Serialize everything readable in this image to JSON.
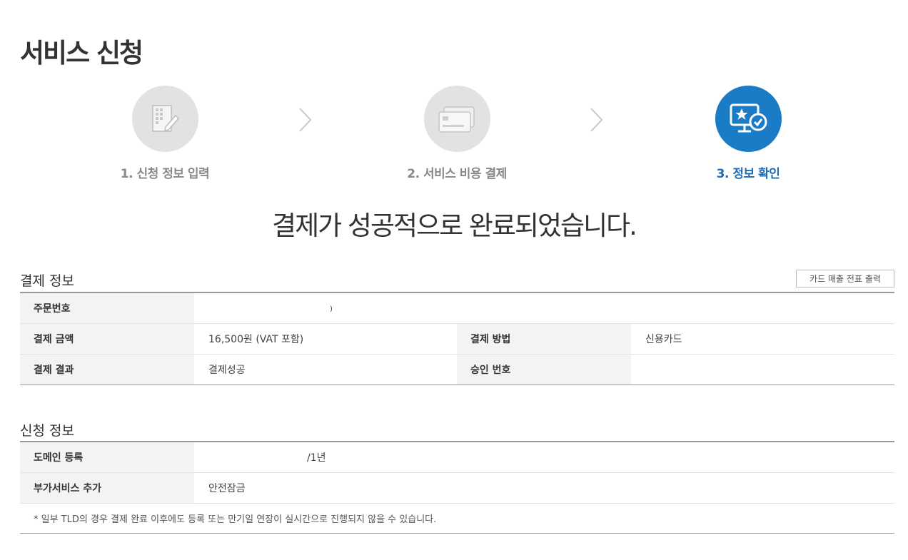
{
  "page_title": "서비스 신청",
  "steps": [
    {
      "label": "1. 신청 정보 입력",
      "icon": "document-edit-icon",
      "active": false
    },
    {
      "label": "2. 서비스 비용 결제",
      "icon": "credit-card-icon",
      "active": false
    },
    {
      "label": "3. 정보 확인",
      "icon": "monitor-check-icon",
      "active": true
    }
  ],
  "colors": {
    "accent": "#1a7bc7",
    "inactive_circle": "#e2e2e2",
    "active_label": "#1a6db5"
  },
  "success_message": "결제가 성공적으로 완료되었습니다.",
  "payment_info": {
    "title": "결제 정보",
    "print_button": "카드 매출 전표 출력",
    "rows": {
      "order_number_label": "주문번호",
      "order_number_value": ")",
      "amount_label": "결제 금액",
      "amount_value": "16,500원 (VAT 포함)",
      "method_label": "결제 방법",
      "method_value": "신용카드",
      "result_label": "결제 결과",
      "result_value": "결제성공",
      "approval_label": "승인 번호",
      "approval_value": ""
    }
  },
  "application_info": {
    "title": "신청 정보",
    "rows": {
      "domain_label": "도메인 등록",
      "domain_value": "/1년",
      "addon_label": "부가서비스 추가",
      "addon_value": "안전잠금"
    },
    "note": "* 일부 TLD의 경우 결제 완료 이후에도 등록 또는 만기일 연장이 실시간으로 진행되지 않을 수 있습니다."
  }
}
